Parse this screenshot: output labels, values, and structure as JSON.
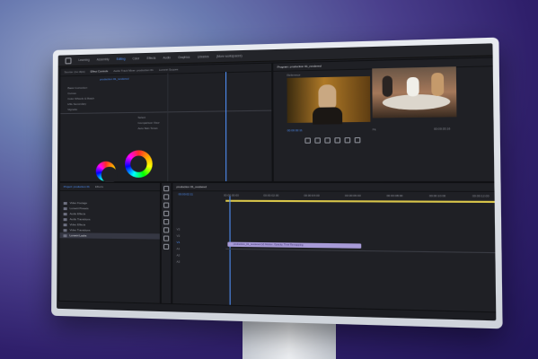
{
  "workspaces": [
    "Learning",
    "Assembly",
    "Editing",
    "Color",
    "Effects",
    "Audio",
    "Graphics",
    "Libraries",
    "(More workspaces)"
  ],
  "active_workspace": "Editing",
  "source_panel": {
    "tabs": [
      "Source: (no clips)",
      "Effect Controls",
      "Audio Track Mixer: production 01",
      "Lumetri Scopes"
    ],
    "clip_label": "production 01_rendered",
    "rows": [
      "Basic Correction",
      "Curves",
      "Color Wheels & Match",
      "HSL Secondary",
      "Vignette"
    ],
    "options": [
      "Select",
      "Comparison View",
      "Auto Skin Tones"
    ]
  },
  "program_panel": {
    "title": "Program: production 01_rendered",
    "reference_label": "Reference",
    "timecode_left": "00:00:02:11",
    "timecode_right": "00:00:03:16",
    "zoom": "Fit"
  },
  "project_panel": {
    "title": "Project: production 01",
    "tab_extra": "Effects",
    "items": [
      "Video Footage",
      "Lumetri Presets",
      "Audio Effects",
      "Audio Transitions",
      "Video Effects",
      "Video Transitions",
      "Lumetri Looks"
    ],
    "selected_index": 6
  },
  "timeline_panel": {
    "title": "production 01_rendered",
    "timecode": "00:00:02:11",
    "ruler": [
      "00:00:00:00",
      "00:00:02:00",
      "00:00:04:00",
      "00:00:06:00",
      "00:00:08:00",
      "00:00:10:00",
      "00:00:12:00"
    ],
    "clip_label": "production_01_rendered [V]",
    "clip_label_2": "Motion, Opacity, Time Remapping",
    "tracks": [
      "V3",
      "V2",
      "V1",
      "A1",
      "A2",
      "A3"
    ]
  },
  "colors": {
    "accent": "#4f8ff7",
    "clip": "#a89bd8",
    "panel": "#1f2025"
  }
}
